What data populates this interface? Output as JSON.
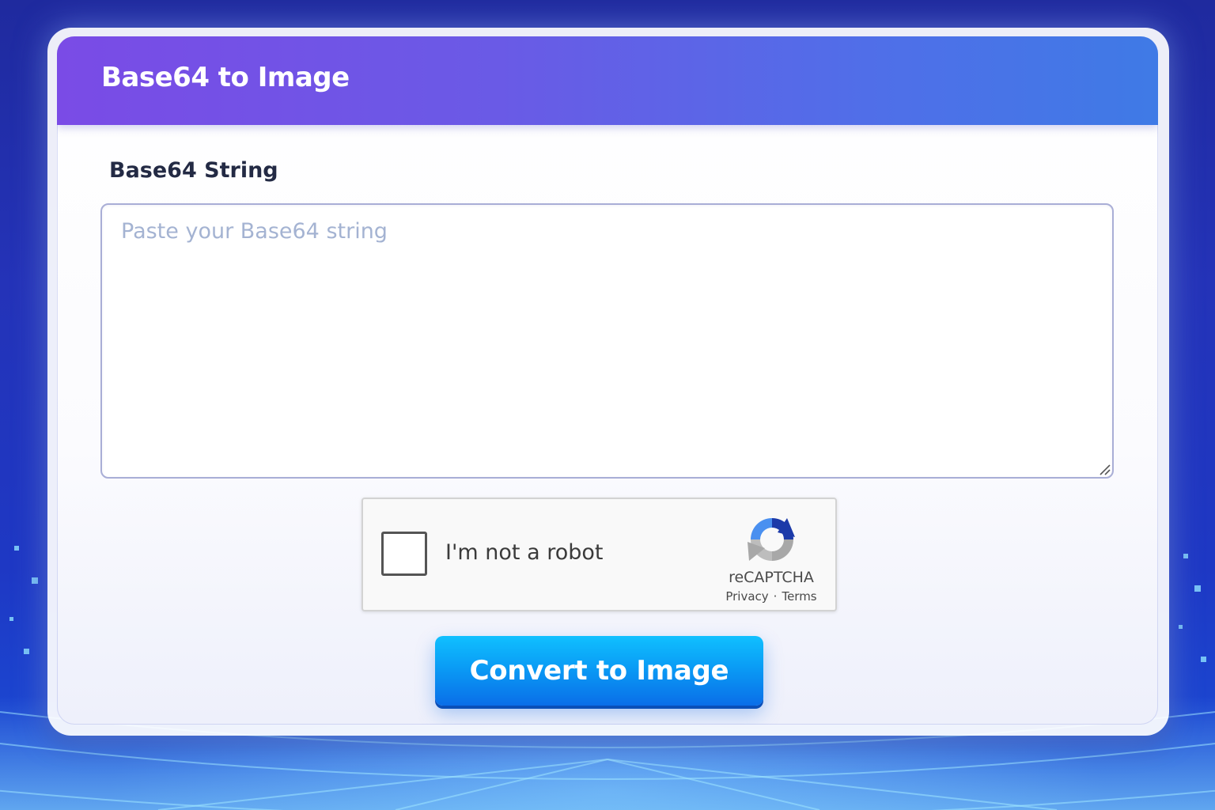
{
  "header": {
    "title": "Base64 to Image"
  },
  "form": {
    "field_label": "Base64 String",
    "input_value": "",
    "input_placeholder": "Paste your Base64 string"
  },
  "captcha": {
    "label": "I'm not a robot",
    "brand": "reCAPTCHA",
    "privacy": "Privacy",
    "separator": "·",
    "terms": "Terms",
    "checked": false
  },
  "actions": {
    "convert_label": "Convert to Image"
  },
  "colors": {
    "header_start": "#7a4be6",
    "header_end": "#3f7ae6",
    "button_start": "#10c0ff",
    "button_end": "#0a6ee8"
  }
}
